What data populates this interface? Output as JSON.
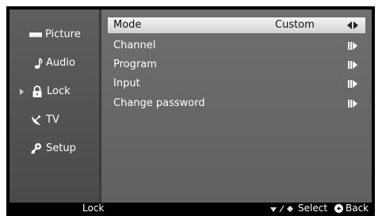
{
  "sidebar": {
    "items": [
      {
        "label": "Picture",
        "icon": "picture-icon"
      },
      {
        "label": "Audio",
        "icon": "note-icon"
      },
      {
        "label": "Lock",
        "icon": "lock-icon",
        "active": true
      },
      {
        "label": "TV",
        "icon": "satellite-dish-icon"
      },
      {
        "label": "Setup",
        "icon": "setup-icon"
      }
    ]
  },
  "menu": {
    "rows": [
      {
        "label": "Mode",
        "value": "Custom",
        "arrow": "left-right-arrows-icon",
        "selected": true
      },
      {
        "label": "Channel",
        "value": "",
        "arrow": "enter-arrow-icon"
      },
      {
        "label": "Program",
        "value": "",
        "arrow": "enter-arrow-icon"
      },
      {
        "label": "Input",
        "value": "",
        "arrow": "enter-arrow-icon"
      },
      {
        "label": "Change password",
        "value": "",
        "arrow": "enter-arrow-icon"
      }
    ]
  },
  "bottom_bar": {
    "title": "Lock",
    "select_label": "Select",
    "back_label": "Back"
  },
  "colors": {
    "sidebar_bg": "#555555",
    "content_bg": "#686868",
    "selected_bg": "#e6e6e6",
    "bar_bg": "#000000"
  }
}
